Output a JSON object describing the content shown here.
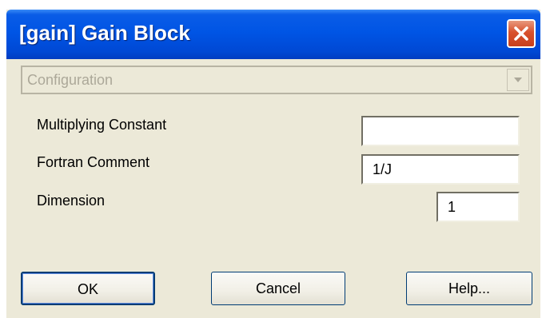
{
  "window": {
    "title": "[gain] Gain Block"
  },
  "configuration": {
    "value": "Configuration"
  },
  "fields": {
    "multiplying_constant": {
      "label": "Multiplying Constant",
      "value": ""
    },
    "fortran_comment": {
      "label": "Fortran Comment",
      "value": "1/J"
    },
    "dimension": {
      "label": "Dimension",
      "value": "1"
    }
  },
  "buttons": {
    "ok": "OK",
    "cancel": "Cancel",
    "help": "Help..."
  },
  "icons": {
    "close": "close-icon",
    "dropdown": "chevron-down-icon"
  },
  "colors": {
    "titlebar": "#0055e5",
    "close": "#d8512d",
    "dialog_bg": "#ece9d8"
  }
}
